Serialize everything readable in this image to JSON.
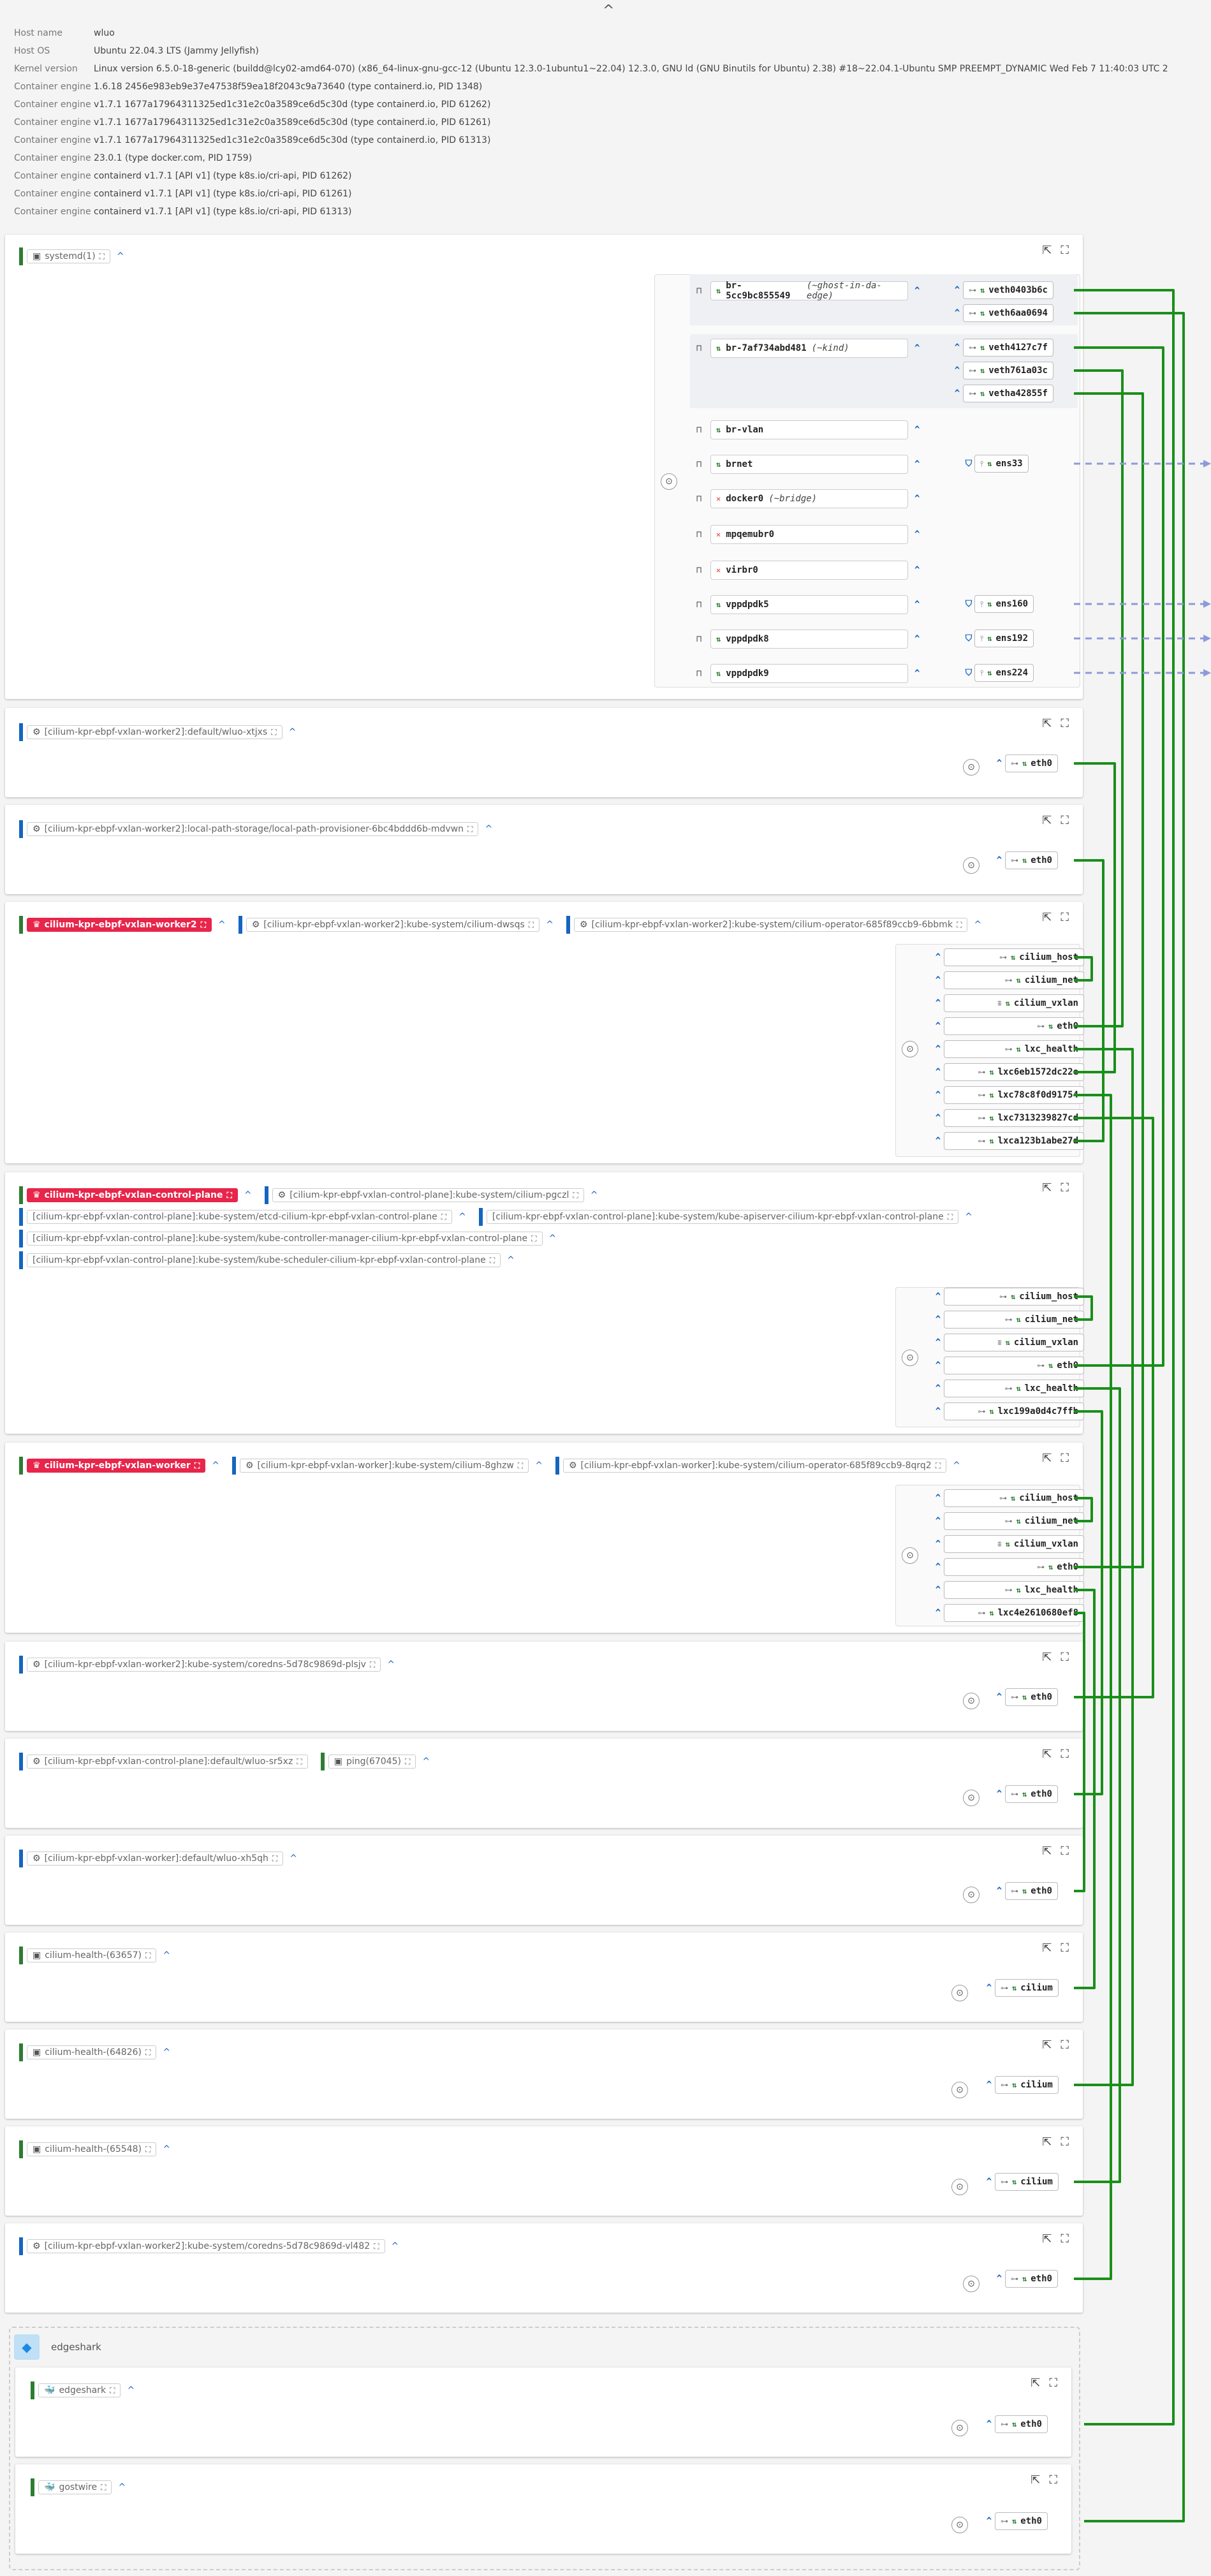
{
  "collapse_glyph": "^",
  "host_info": [
    {
      "key": "Host name",
      "value": "wluo"
    },
    {
      "key": "Host OS",
      "value": "Ubuntu 22.04.3 LTS (Jammy Jellyfish)"
    },
    {
      "key": "Kernel version",
      "value": "Linux version 6.5.0-18-generic (buildd@lcy02-amd64-070) (x86_64-linux-gnu-gcc-12 (Ubuntu 12.3.0-1ubuntu1~22.04) 12.3.0, GNU ld (GNU Binutils for Ubuntu) 2.38) #18~22.04.1-Ubuntu SMP PREEMPT_DYNAMIC Wed Feb 7 11:40:03 UTC 2"
    },
    {
      "key": "Container engine",
      "value": "1.6.18 2456e983eb9e37e47538f59ea18f2043c9a73640 (type containerd.io, PID 1348)"
    },
    {
      "key": "Container engine",
      "value": "v1.7.1 1677a17964311325ed1c31e2c0a3589ce6d5c30d (type containerd.io, PID 61262)"
    },
    {
      "key": "Container engine",
      "value": "v1.7.1 1677a17964311325ed1c31e2c0a3589ce6d5c30d (type containerd.io, PID 61261)"
    },
    {
      "key": "Container engine",
      "value": "v1.7.1 1677a17964311325ed1c31e2c0a3589ce6d5c30d (type containerd.io, PID 61313)"
    },
    {
      "key": "Container engine",
      "value": "23.0.1 (type docker.com, PID 1759)"
    },
    {
      "key": "Container engine",
      "value": "containerd v1.7.1 [API v1] (type k8s.io/cri-api, PID 61262)"
    },
    {
      "key": "Container engine",
      "value": "containerd v1.7.1 [API v1] (type k8s.io/cri-api, PID 61261)"
    },
    {
      "key": "Container engine",
      "value": "containerd v1.7.1 [API v1] (type k8s.io/cri-api, PID 61313)"
    }
  ],
  "root": {
    "chip": "systemd(1)",
    "bridges": [
      {
        "name": "br-5cc9bc855549",
        "alias": "(~ghost-in-da-edge)",
        "up": true
      },
      {
        "name": "br-7af734abd481",
        "alias": "(~kind)",
        "up": true
      },
      {
        "name": "br-vlan",
        "alias": "",
        "up": true
      },
      {
        "name": "brnet",
        "alias": "",
        "up": true
      },
      {
        "name": "docker0",
        "alias": "(~bridge)",
        "up": false
      },
      {
        "name": "mpqemubr0",
        "alias": "",
        "up": false
      },
      {
        "name": "virbr0",
        "alias": "",
        "up": false
      },
      {
        "name": "vppdpdk5",
        "alias": "",
        "up": true
      },
      {
        "name": "vppdpdk8",
        "alias": "",
        "up": true
      },
      {
        "name": "vppdpdk9",
        "alias": "",
        "up": true
      }
    ],
    "ports": [
      "veth0403b6c",
      "veth6aa0694",
      "veth4127c7f",
      "veth761a03c",
      "vetha42855f",
      "ens33",
      "ens160",
      "ens192",
      "ens224"
    ]
  },
  "pods": [
    {
      "chips": [
        "[cilium-kpr-ebpf-vxlan-worker2]:default/wluo-xtjxs"
      ],
      "nif": "eth0"
    },
    {
      "chips": [
        "[cilium-kpr-ebpf-vxlan-worker2]:local-path-storage/local-path-provisioner-6bc4bddd6b-mdvwn"
      ],
      "nif": "eth0"
    },
    {
      "chips": [
        "[cilium-kpr-ebpf-vxlan-worker2]:default/wluo-sr5xz",
        "[cilium-kpr-ebpf-vxlan-worker]:default/wluo-xh5qh"
      ],
      "nif": "eth0"
    }
  ],
  "nodes": [
    {
      "name": "cilium-kpr-ebpf-vxlan-worker2",
      "chips": [
        "[cilium-kpr-ebpf-vxlan-worker2]:kube-system/cilium-dwsqs",
        "[cilium-kpr-ebpf-vxlan-worker2]:kube-system/cilium-operator-685f89ccb9-6bbmk"
      ],
      "nifs": [
        "cilium_host",
        "cilium_net",
        "cilium_vxlan",
        "eth0",
        "lxc_health",
        "lxc6eb1572dc22e",
        "lxc78c8f0d91754",
        "lxc7313239827cd",
        "lxca123b1abe27d"
      ]
    },
    {
      "name": "cilium-kpr-ebpf-vxlan-control-plane",
      "chips": [
        "[cilium-kpr-ebpf-vxlan-control-plane]:kube-system/cilium-pgczl",
        "[cilium-kpr-ebpf-vxlan-control-plane]:kube-system/etcd-cilium-kpr-ebpf-vxlan-control-plane",
        "[cilium-kpr-ebpf-vxlan-control-plane]:kube-system/kube-apiserver-cilium-kpr-ebpf-vxlan-control-plane",
        "[cilium-kpr-ebpf-vxlan-control-plane]:kube-system/kube-controller-manager-cilium-kpr-ebpf-vxlan-control-plane",
        "[cilium-kpr-ebpf-vxlan-control-plane]:kube-system/kube-scheduler-cilium-kpr-ebpf-vxlan-control-plane"
      ],
      "nifs": [
        "cilium_host",
        "cilium_net",
        "cilium_vxlan",
        "eth0",
        "lxc_health",
        "lxc199a0d4c7ffb"
      ]
    },
    {
      "name": "cilium-kpr-ebpf-vxlan-worker",
      "chips": [
        "[cilium-kpr-ebpf-vxlan-worker]:kube-system/cilium-8ghzw",
        "[cilium-kpr-ebpf-vxlan-worker]:kube-system/cilium-operator-685f89ccb9-8qrq2"
      ],
      "nifs": [
        "cilium_host",
        "cilium_net",
        "cilium_vxlan",
        "eth0",
        "lxc_health",
        "lxc4e2610680ef8"
      ]
    }
  ],
  "small_boxes": [
    {
      "chips": [
        "[cilium-kpr-ebpf-vxlan-worker2]:default/wluo-xtjxs"
      ],
      "nif": "eth0"
    },
    {
      "chips": [
        "[cilium-kpr-ebpf-vxlan-worker2]:local-path-storage/local-path-provisioner-6bc4bddd6b-mdvwn"
      ],
      "nif": "eth0"
    },
    {
      "chips": [
        "[cilium-kpr-ebpf-vxlan-worker2]:kube-system/coredns-5d78c9869d-plsjv"
      ],
      "nif": "eth0"
    },
    {
      "chips": [
        "[cilium-kpr-ebpf-vxlan-control-plane]:default/wluo-sr5xz",
        "ping(67045)"
      ],
      "nif": "eth0"
    },
    {
      "chips": [
        "[cilium-kpr-ebpf-vxlan-worker]:default/wluo-xh5qh"
      ],
      "nif": "eth0"
    },
    {
      "chips": [
        "cilium-health-(63657)"
      ],
      "nif": "cilium"
    },
    {
      "chips": [
        "cilium-health-(64826)"
      ],
      "nif": "cilium"
    },
    {
      "chips": [
        "cilium-health-(65548)"
      ],
      "nif": "cilium"
    },
    {
      "chips": [
        "[cilium-kpr-ebpf-vxlan-worker2]:kube-system/coredns-5d78c9869d-vl482"
      ],
      "nif": "eth0"
    }
  ],
  "edgeshark": {
    "title": "edgeshark",
    "children": [
      {
        "chip": "edgeshark",
        "nif": "eth0"
      },
      {
        "chip": "gostwire",
        "nif": "eth0"
      }
    ]
  },
  "colors": {
    "accent": "#1565c0",
    "wire": "#1a8f1a",
    "node_red": "#e8254a",
    "dashed_wire": "#8e9ad8"
  }
}
